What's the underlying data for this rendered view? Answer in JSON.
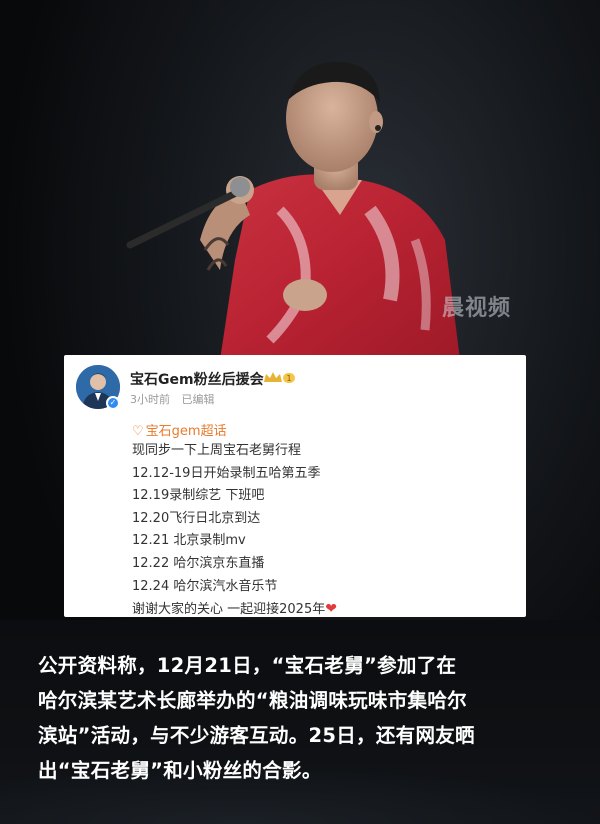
{
  "watermark": "晨视频",
  "post": {
    "account_name": "宝石Gem粉丝后援会",
    "time": "3小时前",
    "edited": "已编辑",
    "topic": "宝石gem超话",
    "lines": [
      "现同步一下上周宝石老舅行程",
      "12.12-19日开始录制五哈第五季",
      "12.19录制综艺 下班吧",
      "12.20飞行日北京到达",
      "12.21 北京录制mv",
      "12.22 哈尔滨京东直播",
      "12.24 哈尔滨汽水音乐节",
      "谢谢大家的关心  一起迎接2025年"
    ],
    "heart_icon": "heart-icon",
    "colors": {
      "topic": "#e87b2c",
      "heart": "#e23b3b",
      "verify": "#2f8cf0"
    }
  },
  "caption": {
    "lines": [
      "公开资料称，12月21日，“宝石老舅”参加了在",
      "哈尔滨某艺术长廊举办的“粮油调味玩味市集哈尔",
      "滨站”活动，与不少游客互动。25日，还有网友晒",
      "出“宝石老舅”和小粉丝的合影。"
    ]
  }
}
